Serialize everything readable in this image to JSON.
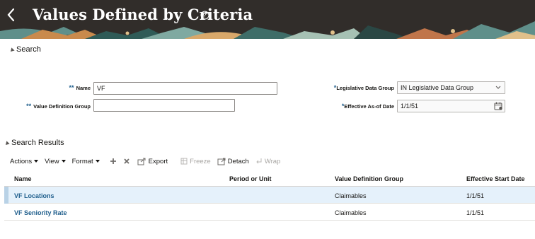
{
  "header": {
    "title": "Values Defined by Criteria",
    "back_icon": "chevron-left-icon",
    "help_icon": "help-circle-icon",
    "background": "#312d2a"
  },
  "search": {
    "section_label": "Search",
    "fields": {
      "name": {
        "required_mark": "**",
        "label": "Name",
        "value": "VF"
      },
      "value_definition_group": {
        "required_mark": "**",
        "label": "Value Definition Group",
        "value": ""
      },
      "legislative_data_group": {
        "required_mark": "*",
        "label": "Legislative Data Group",
        "value": "IN Legislative Data Group"
      },
      "effective_as_of_date": {
        "required_mark": "*",
        "label": "Effective As-of Date",
        "value": "1/1/51"
      }
    }
  },
  "results": {
    "section_label": "Search Results",
    "toolbar": {
      "actions": "Actions",
      "view": "View",
      "format": "Format",
      "add_icon": "plus-icon",
      "delete_icon": "x-icon",
      "export": "Export",
      "freeze": "Freeze",
      "detach": "Detach",
      "wrap": "Wrap"
    },
    "columns": [
      "Name",
      "Period or Unit",
      "Value Definition Group",
      "Effective Start Date"
    ],
    "rows": [
      {
        "name": "VF Locations",
        "period_or_unit": "",
        "value_definition_group": "Claimables",
        "effective_start_date": "1/1/51",
        "selected": true
      },
      {
        "name": "VF Seniority Rate",
        "period_or_unit": "",
        "value_definition_group": "Claimables",
        "effective_start_date": "1/1/51",
        "selected": false
      }
    ]
  },
  "colors": {
    "accent": "#1f5e8c",
    "selected_row": "#e5f1fb"
  }
}
